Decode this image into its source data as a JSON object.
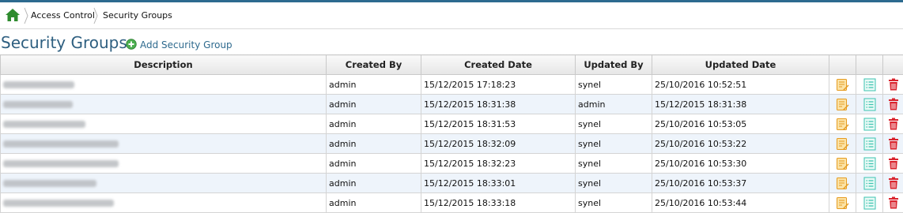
{
  "breadcrumb": {
    "items": [
      {
        "label": "Access Control"
      },
      {
        "label": "Security Groups"
      }
    ]
  },
  "page": {
    "title": "Security Groups",
    "add_label": "Add Security Group"
  },
  "table": {
    "columns": [
      "Description",
      "Created By",
      "Created Date",
      "Updated By",
      "Updated Date",
      "",
      "",
      ""
    ],
    "rows": [
      {
        "created_by": "admin",
        "created_date": "15/12/2015 17:18:23",
        "updated_by": "synel",
        "updated_date": "25/10/2016 10:52:51"
      },
      {
        "created_by": "admin",
        "created_date": "15/12/2015 18:31:38",
        "updated_by": "admin",
        "updated_date": "15/12/2015 18:31:38"
      },
      {
        "created_by": "admin",
        "created_date": "15/12/2015 18:31:53",
        "updated_by": "synel",
        "updated_date": "25/10/2016 10:53:05"
      },
      {
        "created_by": "admin",
        "created_date": "15/12/2015 18:32:09",
        "updated_by": "synel",
        "updated_date": "25/10/2016 10:53:22"
      },
      {
        "created_by": "admin",
        "created_date": "15/12/2015 18:32:23",
        "updated_by": "synel",
        "updated_date": "25/10/2016 10:53:30"
      },
      {
        "created_by": "admin",
        "created_date": "15/12/2015 18:33:01",
        "updated_by": "synel",
        "updated_date": "25/10/2016 10:53:37"
      },
      {
        "created_by": "admin",
        "created_date": "15/12/2015 18:33:18",
        "updated_by": "synel",
        "updated_date": "25/10/2016 10:53:44"
      }
    ],
    "row_actions": [
      "edit-icon",
      "details-list-icon",
      "trash-icon"
    ]
  },
  "colors": {
    "title": "#2e5f80",
    "link": "#2e6a8e",
    "home_icon": "#2e8b2e",
    "alt_row": "#eef4fb",
    "edit_icon": "#f0a830",
    "list_icon": "#3cc3b0",
    "delete_icon": "#d9232d"
  }
}
